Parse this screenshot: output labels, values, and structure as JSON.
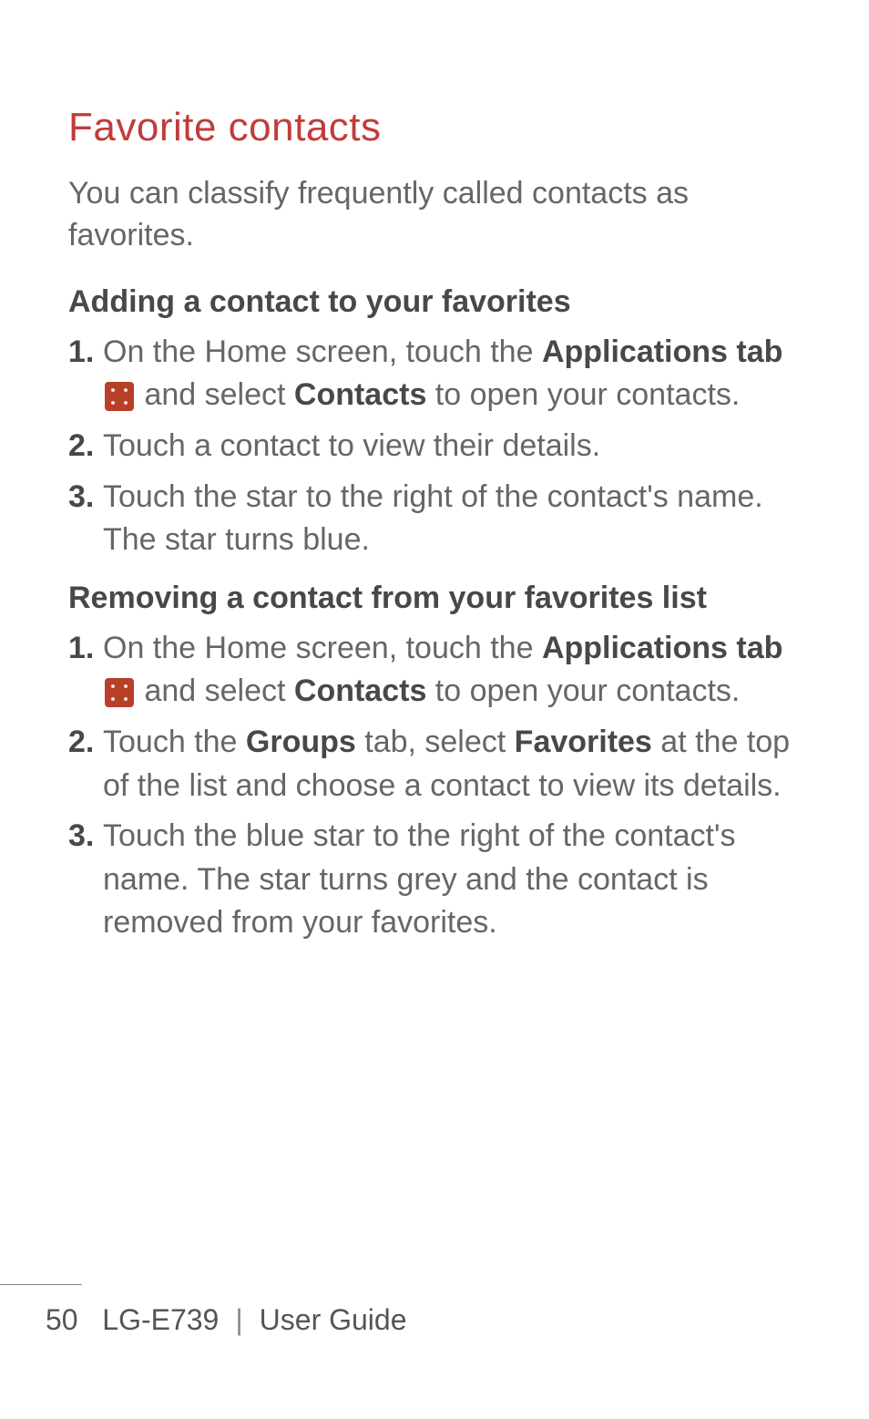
{
  "heading": "Favorite contacts",
  "intro": "You can classify frequently called contacts as favorites.",
  "section1": {
    "title": "Adding a contact to your favorites",
    "items": [
      {
        "num": "1.",
        "pre": " On the Home screen, touch the ",
        "bold1": "Applications tab",
        "mid": " and select ",
        "bold2": "Contacts",
        "post": " to open your contacts.",
        "hasIcon": true
      },
      {
        "num": "2.",
        "text": "Touch a contact to view their details."
      },
      {
        "num": "3.",
        "text": "Touch the star to the right of the contact's name. The star turns blue."
      }
    ]
  },
  "section2": {
    "title": "Removing a contact from your favorites list",
    "items": [
      {
        "num": "1.",
        "pre": " On the Home screen, touch the ",
        "bold1": "Applications tab",
        "mid": " and select ",
        "bold2": "Contacts",
        "post": " to open your contacts.",
        "hasIcon": true
      },
      {
        "num": "2.",
        "preText": "Touch the ",
        "bold1": "Groups",
        "midText": " tab, select ",
        "bold2": "Favorites",
        "postText": " at the top of the list and choose a contact to view its details."
      },
      {
        "num": "3.",
        "text": "Touch the blue star to the right of the contact's name. The star turns grey and the contact is removed from your favorites."
      }
    ]
  },
  "footer": {
    "pageNum": "50",
    "model": "LG-E739",
    "guide": "User Guide"
  }
}
